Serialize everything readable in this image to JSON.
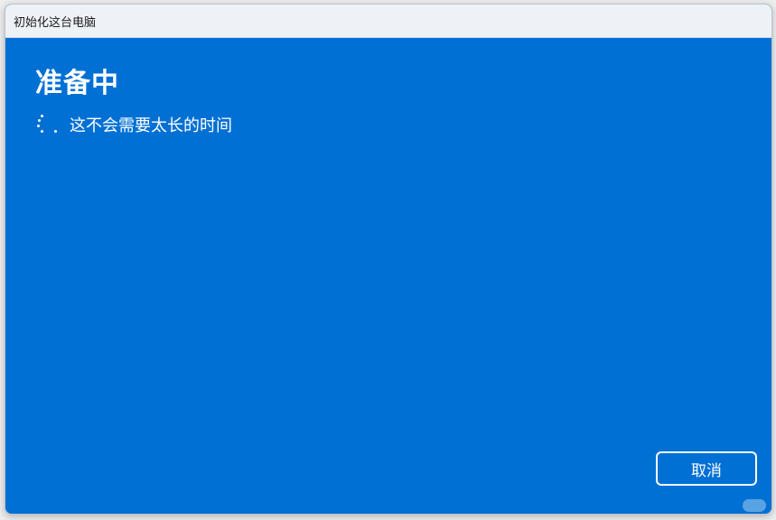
{
  "window": {
    "title": "初始化这台电脑"
  },
  "main": {
    "heading": "准备中",
    "status_text": "这不会需要太长的时间"
  },
  "actions": {
    "cancel_label": "取消"
  },
  "colors": {
    "dialog_background": "#0170d4",
    "titlebar_background": "#eef2f7",
    "text": "#ffffff"
  },
  "icons": {
    "spinner": "loading-spinner-icon"
  }
}
